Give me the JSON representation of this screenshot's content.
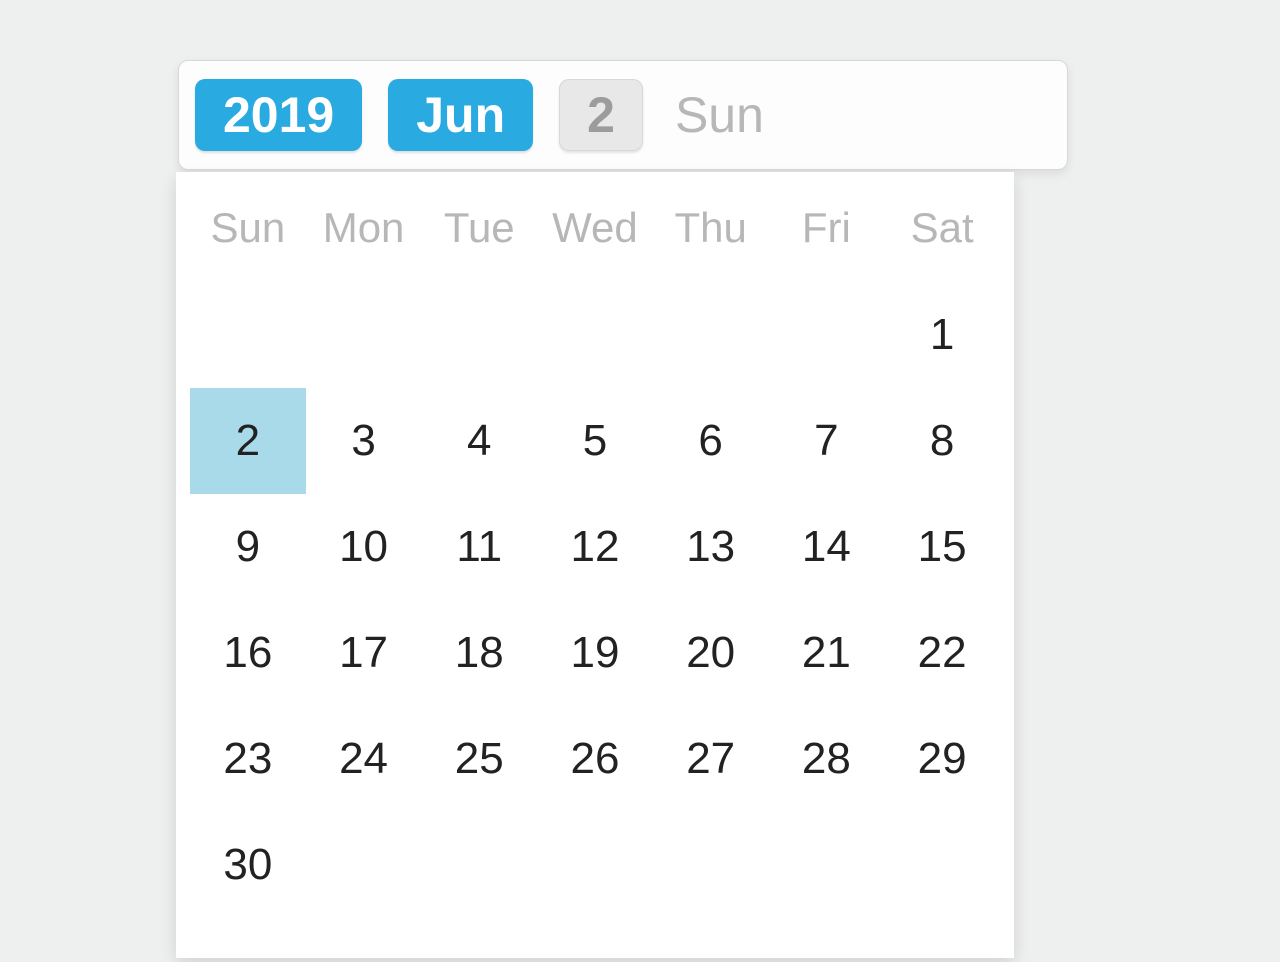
{
  "colors": {
    "accent": "#29aae1",
    "selected": "#a9daea",
    "muted": "#b7b7b7",
    "pill_gray_bg": "#e8e8e8"
  },
  "header": {
    "year": "2019",
    "month": "Jun",
    "day": "2",
    "dow": "Sun"
  },
  "calendar": {
    "dow_headers": [
      "Sun",
      "Mon",
      "Tue",
      "Wed",
      "Thu",
      "Fri",
      "Sat"
    ],
    "selected_day": 2,
    "weeks": [
      [
        "",
        "",
        "",
        "",
        "",
        "",
        "1"
      ],
      [
        "2",
        "3",
        "4",
        "5",
        "6",
        "7",
        "8"
      ],
      [
        "9",
        "10",
        "11",
        "12",
        "13",
        "14",
        "15"
      ],
      [
        "16",
        "17",
        "18",
        "19",
        "20",
        "21",
        "22"
      ],
      [
        "23",
        "24",
        "25",
        "26",
        "27",
        "28",
        "29"
      ],
      [
        "30",
        "",
        "",
        "",
        "",
        "",
        ""
      ]
    ]
  }
}
